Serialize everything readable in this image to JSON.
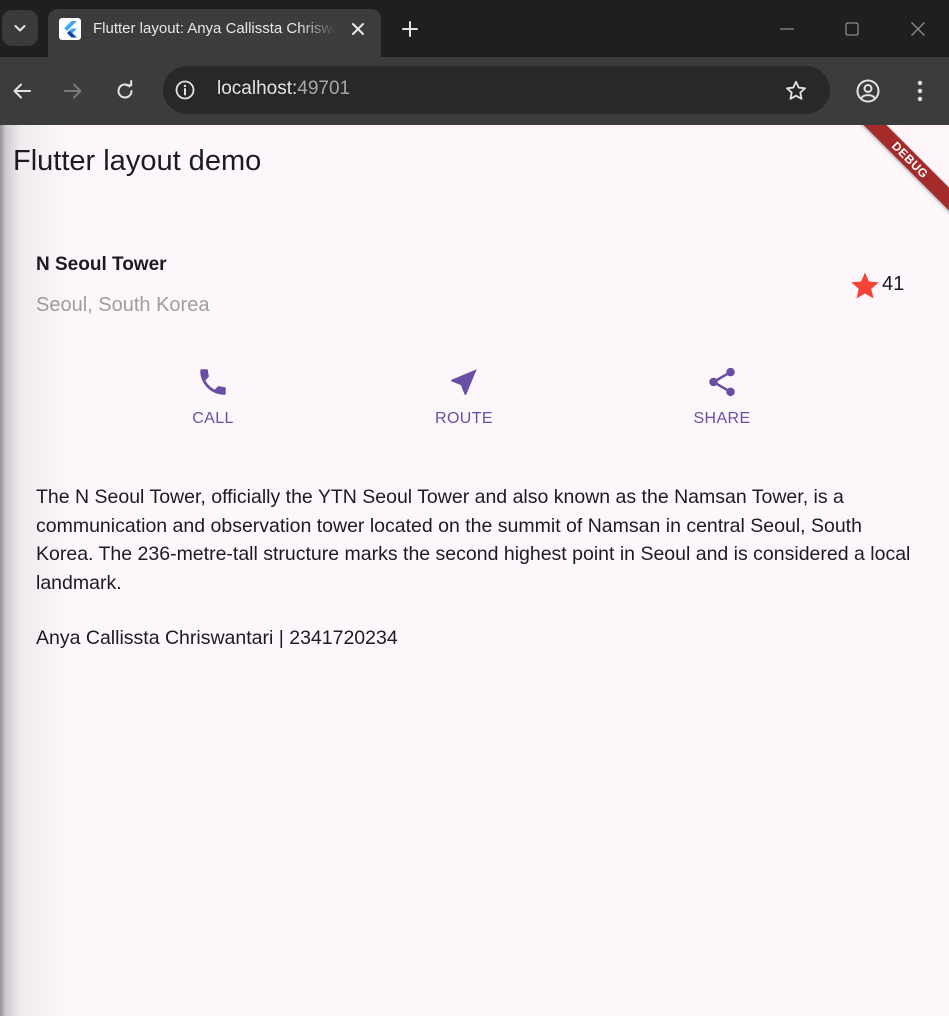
{
  "browser": {
    "tab": {
      "title": "Flutter layout: Anya Callissta Chriswantari",
      "close_symbol": "✕"
    },
    "new_tab_symbol": "+",
    "address": {
      "host": "localhost:",
      "port": "49701"
    },
    "icons": [
      "tab-search-icon",
      "flutter-logo-icon",
      "close-icon",
      "new-tab-icon",
      "minimize-icon",
      "maximize-icon",
      "window-close-icon",
      "back-arrow-icon",
      "forward-arrow-icon",
      "reload-icon",
      "site-info-icon",
      "bookmark-star-icon",
      "profile-icon",
      "menu-dots-icon"
    ]
  },
  "app": {
    "title": "Flutter layout demo",
    "debug_banner": "DEBUG"
  },
  "place": {
    "name": "N Seoul Tower",
    "location": "Seoul, South Korea",
    "rating_count": "41",
    "rating_star_color": "#f44336"
  },
  "actions": [
    {
      "label": "CALL",
      "icon": "phone-icon"
    },
    {
      "label": "ROUTE",
      "icon": "navigation-icon"
    },
    {
      "label": "SHARE",
      "icon": "share-icon"
    }
  ],
  "accent_color": "#6750a4",
  "description": "The N Seoul Tower, officially the YTN Seoul Tower and also known as the Namsan Tower, is a communication and observation tower located on the summit of Namsan in central Seoul, South Korea. The 236-metre-tall structure marks the second highest point in Seoul and is considered a local landmark.",
  "author": "Anya Callissta Chriswantari | 2341720234"
}
